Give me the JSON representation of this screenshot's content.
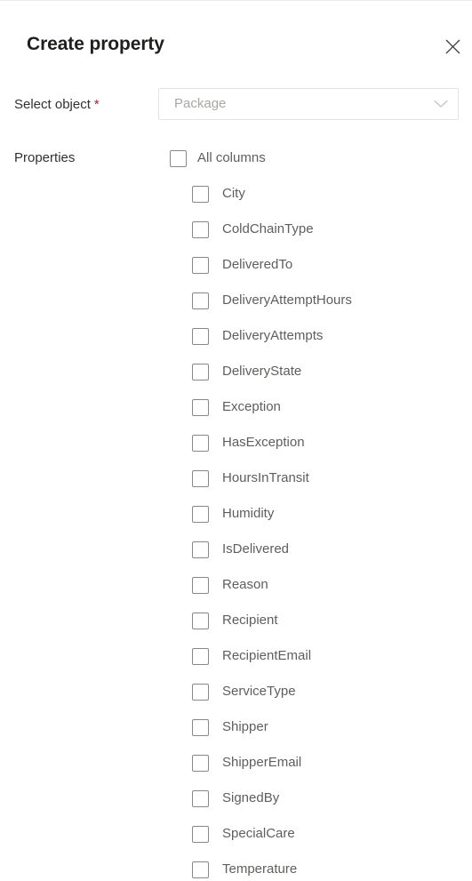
{
  "panel": {
    "title": "Create property",
    "close_icon": "close-icon"
  },
  "form": {
    "select_object": {
      "label": "Select object",
      "required_mark": "*",
      "dropdown_value": "Package",
      "dropdown_placeholder": "Package",
      "chevron_icon": "chevron-down-icon"
    },
    "properties": {
      "label": "Properties",
      "all_columns_label": "All columns",
      "all_columns_checked": false,
      "items": [
        {
          "label": "City",
          "checked": false
        },
        {
          "label": "ColdChainType",
          "checked": false
        },
        {
          "label": "DeliveredTo",
          "checked": false
        },
        {
          "label": "DeliveryAttemptHours",
          "checked": false
        },
        {
          "label": "DeliveryAttempts",
          "checked": false
        },
        {
          "label": "DeliveryState",
          "checked": false
        },
        {
          "label": "Exception",
          "checked": false
        },
        {
          "label": "HasException",
          "checked": false
        },
        {
          "label": "HoursInTransit",
          "checked": false
        },
        {
          "label": "Humidity",
          "checked": false
        },
        {
          "label": "IsDelivered",
          "checked": false
        },
        {
          "label": "Reason",
          "checked": false
        },
        {
          "label": "Recipient",
          "checked": false
        },
        {
          "label": "RecipientEmail",
          "checked": false
        },
        {
          "label": "ServiceType",
          "checked": false
        },
        {
          "label": "Shipper",
          "checked": false
        },
        {
          "label": "ShipperEmail",
          "checked": false
        },
        {
          "label": "SignedBy",
          "checked": false
        },
        {
          "label": "SpecialCare",
          "checked": false
        },
        {
          "label": "Temperature",
          "checked": false
        }
      ]
    }
  },
  "colors": {
    "title_text": "#201f1e",
    "label_text": "#323130",
    "item_text": "#605e5c",
    "placeholder_text": "#a9a7a5",
    "required_red": "#a4262c",
    "checkbox_border": "#8a8886",
    "field_border": "#e6e4e2",
    "panel_background": "#ffffff"
  }
}
